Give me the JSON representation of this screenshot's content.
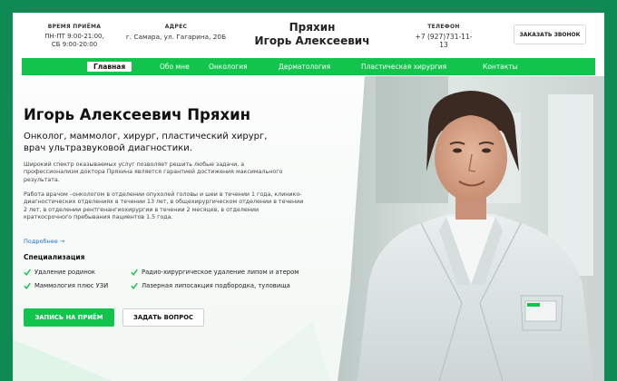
{
  "header": {
    "hours_caption": "ВРЕМЯ ПРИЁМА",
    "hours_line1": "ПН-ПТ 9:00-21:00,",
    "hours_line2": "СБ 9:00-20:00",
    "address_caption": "АДРЕС",
    "address": "г. Самара, ул. Гагарина, 20Б",
    "brand_line1": "Пряхин",
    "brand_line2": "Игорь Алексеевич",
    "phone_caption": "ТЕЛЕФОН",
    "phone": "+7 (927)731-11-13",
    "call_button": "ЗАКАЗАТЬ ЗВОНОК"
  },
  "nav": {
    "items": [
      "Главная",
      "Обо мне",
      "Онкология",
      "Дерматология",
      "Пластическая хирургия",
      "Контакты"
    ],
    "active": "Главная"
  },
  "hero": {
    "title": "Игорь Алексеевич Пряхин",
    "subtitle": "Онколог, маммолог, хирург, пластический хирург, врач ультразвуковой диагностики.",
    "paragraph1": "Широкий спектр оказываемых услуг позволяет решить любые задачи, а профессионализм доктора Пряхина является гарантией достижения максимального результата.",
    "paragraph2": "Работа врачом –онкологом в отделении опухолей головы и шеи в течении 1 года, клинико-диагностических отделениях в течении 13 лет, в общехирургическом отделении в течении 2 лет, в отделении рентгенангиохирургии в течении 2 месяцев, в отделении краткосрочного пребывания пациентов 1.5 года.",
    "more_link": "Подробнее →",
    "specialization_title": "Специализация",
    "specializations": [
      "Удаление родинок",
      "Радио-хирургическое удаление липом и атером",
      "Маммология плюс УЗИ",
      "Лазерная липосакция подбородка, туловища"
    ],
    "primary_button": "ЗАПИСЬ НА ПРИЁМ",
    "secondary_button": "ЗАДАТЬ ВОПРОС"
  },
  "colors": {
    "border_green": "#0f8a55",
    "accent_green": "#12c44c",
    "link_blue": "#1b6fd6"
  }
}
